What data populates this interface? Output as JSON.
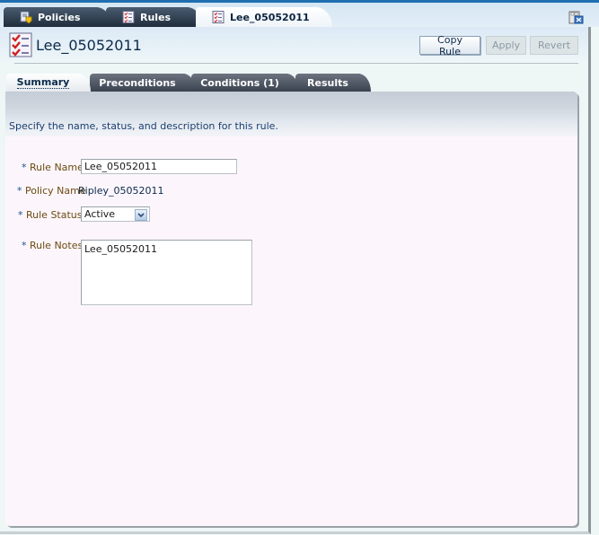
{
  "doc_tabs": [
    {
      "label": "Policies",
      "icon": "policies-icon",
      "active": false
    },
    {
      "label": "Rules",
      "icon": "rules-checklist-icon",
      "active": false
    },
    {
      "label": "Lee_05052011",
      "icon": "rule-checklist-icon",
      "active": true
    }
  ],
  "header": {
    "title": "Lee_05052011",
    "title_icon": "rule-checklist-icon",
    "buttons": {
      "copy_rule": "Copy Rule",
      "apply": "Apply",
      "revert": "Revert"
    }
  },
  "sub_tabs": [
    {
      "label": "Summary",
      "active": true
    },
    {
      "label": "Preconditions",
      "active": false
    },
    {
      "label": "Conditions (1)",
      "active": false
    },
    {
      "label": "Results",
      "active": false
    }
  ],
  "summary": {
    "instruction": "Specify the name, status, and description for this rule.",
    "required_marker": "*",
    "rule_name_label": "Rule Name",
    "rule_name_value": "Lee_05052011",
    "policy_name_label": "Policy Name",
    "policy_name_value": "Ripley_05052011",
    "rule_status_label": "Rule Status",
    "rule_status_value": "Active",
    "rule_notes_label": "Rule Notes",
    "rule_notes_value": "Lee_05052011"
  },
  "colors": {
    "accent_blue": "#1e6fb0",
    "label_brown": "#6b4a10",
    "text_navy": "#0b2a4a"
  }
}
